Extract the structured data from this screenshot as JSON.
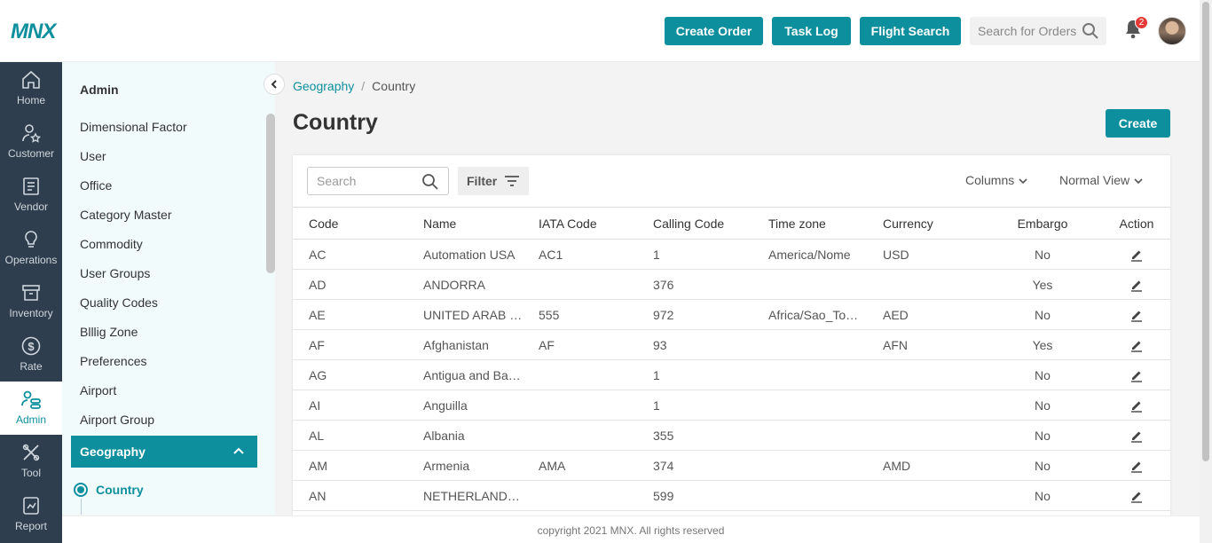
{
  "logo": "MNX",
  "header": {
    "create_order": "Create Order",
    "task_log": "Task Log",
    "flight_search": "Flight Search",
    "search_placeholder": "Search for Orders",
    "notification_count": "2"
  },
  "leftnav": [
    "Home",
    "Customer",
    "Vendor",
    "Operations",
    "Inventory",
    "Rate",
    "Admin",
    "Tool",
    "Report"
  ],
  "submenu": {
    "title": "Admin",
    "items": [
      "Dimensional Factor",
      "User",
      "Office",
      "Category Master",
      "Commodity",
      "User Groups",
      "Quality Codes",
      "Blllig Zone",
      "Preferences",
      "Airport",
      "Airport Group"
    ],
    "group": "Geography",
    "child": "Country"
  },
  "breadcrumb": {
    "parent": "Geography",
    "current": "Country"
  },
  "page_title": "Country",
  "create_label": "Create",
  "toolbar": {
    "search_placeholder": "Search",
    "filter": "Filter",
    "columns": "Columns",
    "view": "Normal View"
  },
  "table": {
    "headers": [
      "Code",
      "Name",
      "IATA Code",
      "Calling Code",
      "Time zone",
      "Currency",
      "Embargo",
      "Action"
    ],
    "rows": [
      [
        "AC",
        "Automation USA",
        "AC1",
        "1",
        "America/Nome",
        "USD",
        "No"
      ],
      [
        "AD",
        "ANDORRA",
        "",
        "376",
        "",
        "",
        "Yes"
      ],
      [
        "AE",
        "UNITED ARAB …",
        "555",
        "972",
        "Africa/Sao_To…",
        "AED",
        "No"
      ],
      [
        "AF",
        "Afghanistan",
        "AF",
        "93",
        "",
        "AFN",
        "Yes"
      ],
      [
        "AG",
        "Antigua and Ba…",
        "",
        "1",
        "",
        "",
        "No"
      ],
      [
        "AI",
        "Anguilla",
        "",
        "1",
        "",
        "",
        "No"
      ],
      [
        "AL",
        "Albania",
        "",
        "355",
        "",
        "",
        "No"
      ],
      [
        "AM",
        "Armenia",
        "AMA",
        "374",
        "",
        "AMD",
        "No"
      ],
      [
        "AN",
        "NETHERLAND…",
        "",
        "599",
        "",
        "",
        "No"
      ]
    ]
  },
  "footer": "copyright 2021 MNX. All rights reserved"
}
